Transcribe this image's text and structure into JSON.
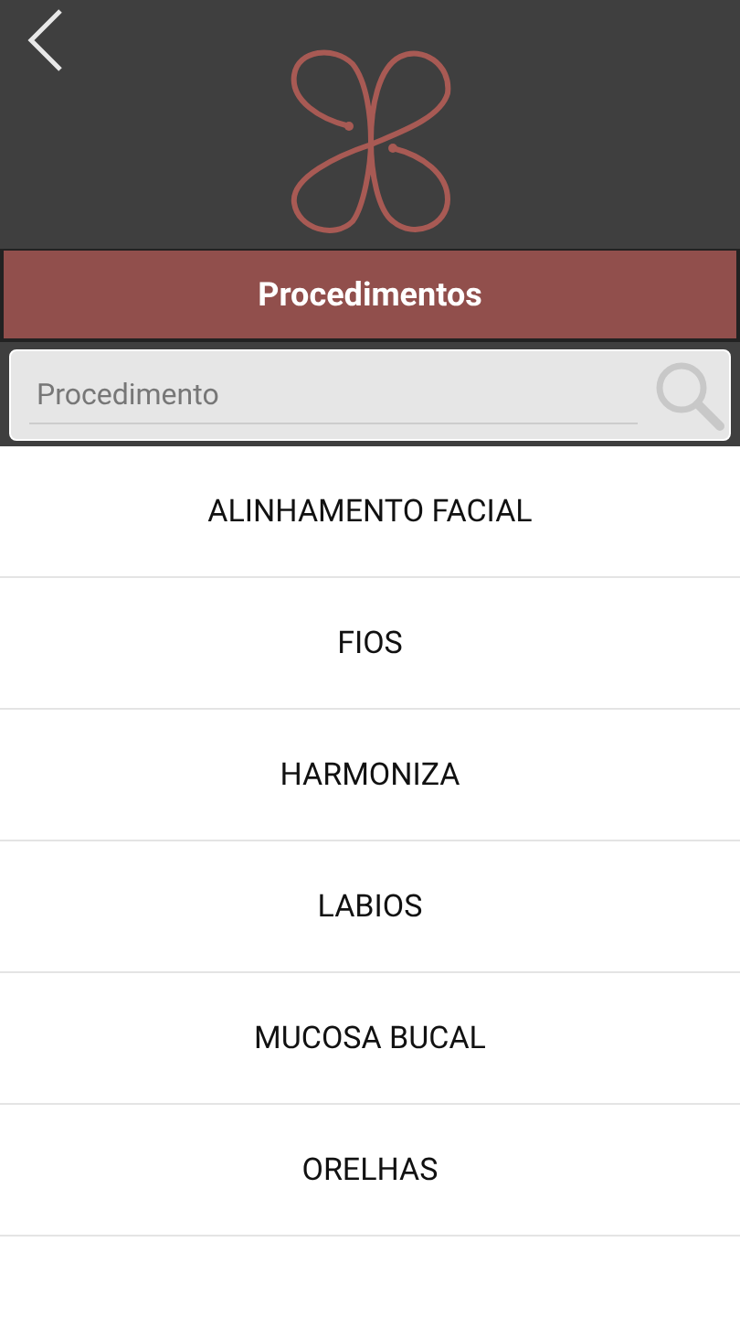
{
  "header": {
    "title": "Procedimentos"
  },
  "search": {
    "placeholder": "Procedimento"
  },
  "items": [
    {
      "label": "ALINHAMENTO FACIAL"
    },
    {
      "label": "FIOS"
    },
    {
      "label": "HARMONIZA"
    },
    {
      "label": "LABIOS"
    },
    {
      "label": "MUCOSA BUCAL"
    },
    {
      "label": "ORELHAS"
    }
  ]
}
